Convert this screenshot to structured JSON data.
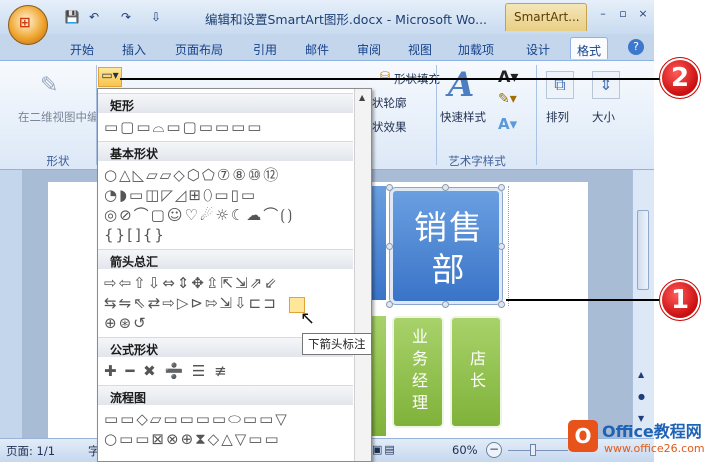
{
  "window": {
    "doc_title": "编辑和设置SmartArt图形.docx - Microsoft Wo...",
    "context_tab": "SmartArt...",
    "controls": [
      "–",
      "▫",
      "×"
    ]
  },
  "quick_access": {
    "save": "💾",
    "undo": "↶",
    "redo": "↷",
    "more": "⇩"
  },
  "tabs": [
    "开始",
    "插入",
    "页面布局",
    "引用",
    "邮件",
    "审阅",
    "视图",
    "加载项",
    "设计",
    "格式"
  ],
  "active_tab": "格式",
  "ribbon": {
    "edit_in_2d": "在二维视图中编辑",
    "shapes_group_label": "形状",
    "shape_fill": "形状填充",
    "shape_outline": "状轮廓",
    "shape_effects": "状效果",
    "quick_styles": "快速样式",
    "art_text_group_label": "艺术字样式",
    "arrange": "排列",
    "size": "大小"
  },
  "gallery": {
    "sections": [
      {
        "title": "矩形",
        "rows": [
          "▭▢▭⌓▭▢▭▭▭▭"
        ]
      },
      {
        "title": "基本形状",
        "rows": [
          "○△◺▱▱◇⬡⬠⑦⑧⑩⑫",
          "◔◗▭◫◸◿⊞⬯▭▯▭",
          "◎⊘⌒▢☺♡☄☼☾☁⌒⟮⟯",
          "{}[]{}"
        ]
      },
      {
        "title": "箭头总汇",
        "rows": [
          "⇨⇦⇧⇩⇔⇕✥⇫⇱⇲⇗⇙",
          "⇆⇋⇖⇄⇨▷⊳⇰⇲⇩⊏⊐",
          "⊕⊛↺"
        ]
      },
      {
        "title": "公式形状",
        "rows": [
          "✚ ━ ✖ ➗ ☰ ≢"
        ]
      },
      {
        "title": "流程图",
        "rows": [
          "▭▭◇▱▭▭▭▭⬭▭▭▽",
          "○▭▭⊠⊗⊕⧗◇△▽▭▭"
        ]
      }
    ],
    "tooltip": "下箭头标注"
  },
  "smartart": {
    "sales_dept": "销售部",
    "business_manager": "业务经理",
    "store_manager": "店长"
  },
  "callouts": [
    "2",
    "1"
  ],
  "status": {
    "page": "页面: 1/1",
    "char": "字",
    "zoom": "60%"
  },
  "watermark": {
    "brand": "Office教程网",
    "url": "www.office26.com"
  }
}
